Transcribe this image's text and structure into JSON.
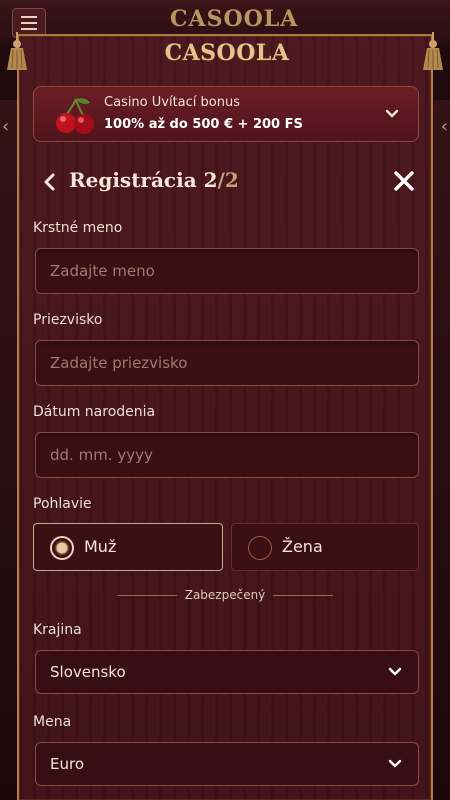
{
  "background": {
    "logo": "CASOOLA"
  },
  "modal": {
    "logo": "CASOOLA",
    "bonus": {
      "title": "Casino Uvítací bonus",
      "offer": "100% až do 500 € + 200 FS",
      "icon": "cherry-icon"
    },
    "header": {
      "title": "Registrácia 2",
      "step_total": "/2"
    },
    "fields": {
      "first_name": {
        "label": "Krstné meno",
        "placeholder": "Zadajte meno"
      },
      "last_name": {
        "label": "Priezvisko",
        "placeholder": "Zadajte priezvisko"
      },
      "birth_date": {
        "label": "Dátum narodenia",
        "placeholder": "dd. mm. yyyy"
      }
    },
    "gender": {
      "label": "Pohlavie",
      "options": [
        {
          "label": "Muž",
          "selected": true
        },
        {
          "label": "Žena",
          "selected": false
        }
      ]
    },
    "secured": "Zabezpečený",
    "country": {
      "label": "Krajina",
      "value": "Slovensko"
    },
    "currency": {
      "label": "Mena",
      "value": "Euro"
    }
  },
  "colors": {
    "accent": "#b07a45",
    "panel": "#4b151c"
  }
}
